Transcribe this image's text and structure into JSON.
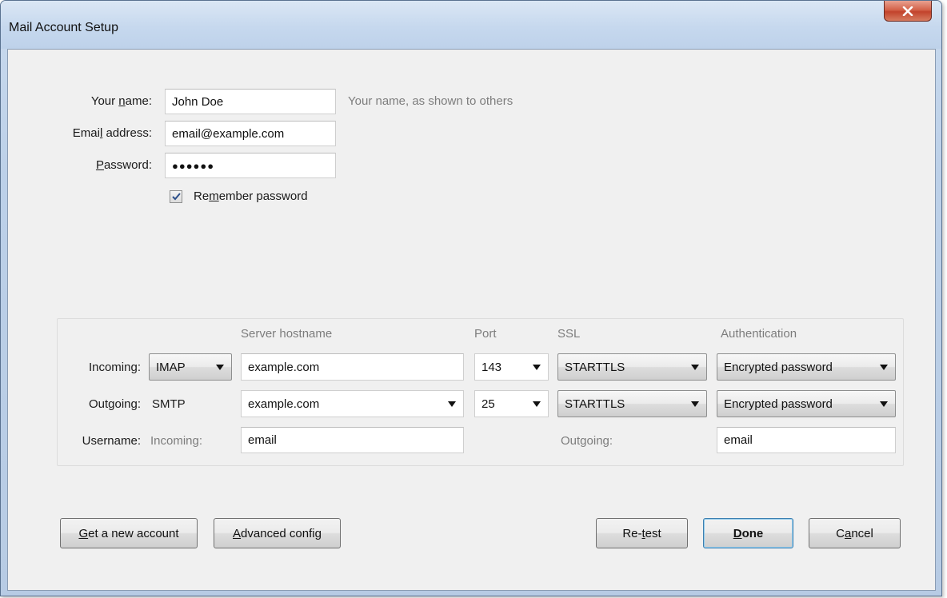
{
  "window": {
    "title": "Mail Account Setup",
    "close_label": "x"
  },
  "identity": {
    "name_label_pre": "Your ",
    "name_label_key": "n",
    "name_label_post": "ame:",
    "name_value": "John Doe",
    "name_hint": "Your name, as shown to others",
    "email_label_pre": "Emai",
    "email_label_key": "l",
    "email_label_post": " address:",
    "email_value": "email@example.com",
    "password_label_key": "P",
    "password_label_post": "assword:",
    "password_value": "●●●●●●",
    "remember_pre": "Re",
    "remember_key": "m",
    "remember_post": "ember password",
    "remember_checked": true
  },
  "server": {
    "headers": {
      "hostname": "Server hostname",
      "port": "Port",
      "ssl": "SSL",
      "auth": "Authentication"
    },
    "incoming": {
      "label": "Incoming:",
      "protocol": "IMAP",
      "hostname": "example.com",
      "port": "143",
      "ssl": "STARTTLS",
      "auth": "Encrypted password"
    },
    "outgoing": {
      "label": "Outgoing:",
      "protocol": "SMTP",
      "hostname": "example.com",
      "port": "25",
      "ssl": "STARTTLS",
      "auth": "Encrypted password"
    },
    "username": {
      "label": "Username:",
      "incoming_label": "Incoming:",
      "incoming_value": "email",
      "outgoing_label": "Outgoing:",
      "outgoing_value": "email"
    }
  },
  "buttons": {
    "get_account_key": "G",
    "get_account_post": "et a new account",
    "advanced_key": "A",
    "advanced_post": "dvanced config",
    "retest_pre": "Re-",
    "retest_key": "t",
    "retest_post": "est",
    "done_key": "D",
    "done_post": "one",
    "cancel_pre": "C",
    "cancel_key": "a",
    "cancel_post": "ncel"
  }
}
